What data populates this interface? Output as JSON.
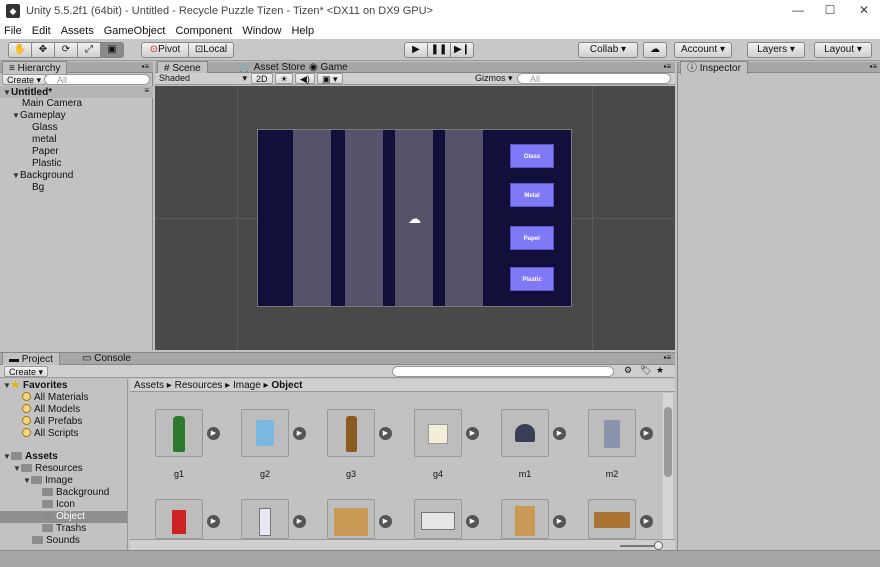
{
  "window": {
    "title": "Unity 5.5.2f1 (64bit) - Untitled - Recycle Puzzle Tizen - Tizen* <DX11 on DX9 GPU>",
    "minimize": "—",
    "maximize": "☐",
    "close": "✕"
  },
  "menu": [
    "File",
    "Edit",
    "Assets",
    "GameObject",
    "Component",
    "Window",
    "Help"
  ],
  "toolbar": {
    "pivot": "Pivot",
    "local": "Local",
    "collab": "Collab ▾",
    "account": "Account",
    "layers": "Layers",
    "layout": "Layout"
  },
  "hierarchy": {
    "tab": "Hierarchy",
    "create": "Create",
    "search_placeholder": "All",
    "scene": "Untitled*",
    "items": [
      "Main Camera",
      "Gameplay",
      "Glass",
      "metal",
      "Paper",
      "Plastic",
      "Background",
      "Bg"
    ]
  },
  "scene": {
    "tabs": [
      "Scene",
      "Asset Store",
      "Game"
    ],
    "shading": "Shaded",
    "mode2d": "2D",
    "gizmos": "Gizmos",
    "search_placeholder": "All",
    "bins": [
      "Glass",
      "Metal",
      "Paper",
      "Plastic"
    ]
  },
  "inspector": {
    "tab": "Inspector"
  },
  "project": {
    "tabs": [
      "Project",
      "Console"
    ],
    "create": "Create",
    "breadcrumb": [
      "Assets",
      "Resources",
      "Image",
      "Object"
    ],
    "favorites": {
      "label": "Favorites",
      "items": [
        "All Materials",
        "All Models",
        "All Prefabs",
        "All Scripts"
      ]
    },
    "assets": {
      "label": "Assets",
      "resources": "Resources",
      "image": "Image",
      "image_children": [
        "Background",
        "Icon",
        "Object",
        "Trashs"
      ],
      "sounds": "Sounds"
    },
    "grid_row1": [
      "g1",
      "g2",
      "g3",
      "g4",
      "m1",
      "m2"
    ]
  },
  "colors": {
    "accent": "#7f79f5",
    "scene_bg": "#4a4a4a",
    "game_bg": "#12103a"
  }
}
